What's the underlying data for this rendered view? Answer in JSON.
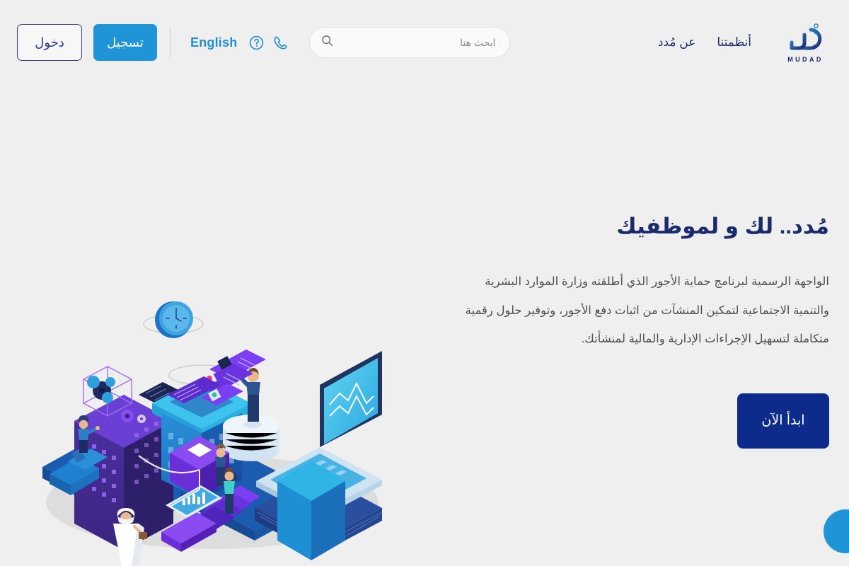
{
  "page": {
    "background_color": "#efefef",
    "direction": "rtl",
    "language": "ar"
  },
  "colors": {
    "brand_navy": "#1b2a6b",
    "brand_blue": "#1f95d8",
    "cta_navy": "#0d2b8a",
    "body_text": "#4f4f4f",
    "background": "#efefef"
  },
  "header": {
    "logo": {
      "wordmark": "MUDAD",
      "arabic_mark": "مُدد",
      "icon_name": "mudad-logo"
    },
    "nav": [
      {
        "label": "أنظمتنا",
        "name": "nav-systems"
      },
      {
        "label": "عن مُدد",
        "name": "nav-about"
      }
    ],
    "search": {
      "placeholder": "ابحث هنا",
      "value": "",
      "icon_name": "search-icon"
    },
    "phone_icon": "phone-icon",
    "help_icon": "question-circle-icon",
    "language_toggle": "English",
    "auth": {
      "login_label": "دخول",
      "register_label": "تسجيل"
    }
  },
  "hero": {
    "title": "مُدد.. لك و لموظفيك",
    "description": "الواجهة الرسمية لبرنامج حماية الأجور الذي أطلقته وزارة الموارد البشرية والتنمية الاجتماعية لتمكين المنشآت من اثبات دفع الأجور، وتوفير حلول رقمية متكاملة لتسهيل الإجراءات الإدارية والمالية لمنشأتك.",
    "cta_label": "ابدأ الآن",
    "illustration_name": "isometric-smart-city-illustration"
  },
  "support": {
    "bubble_name": "support-chat-bubble"
  }
}
